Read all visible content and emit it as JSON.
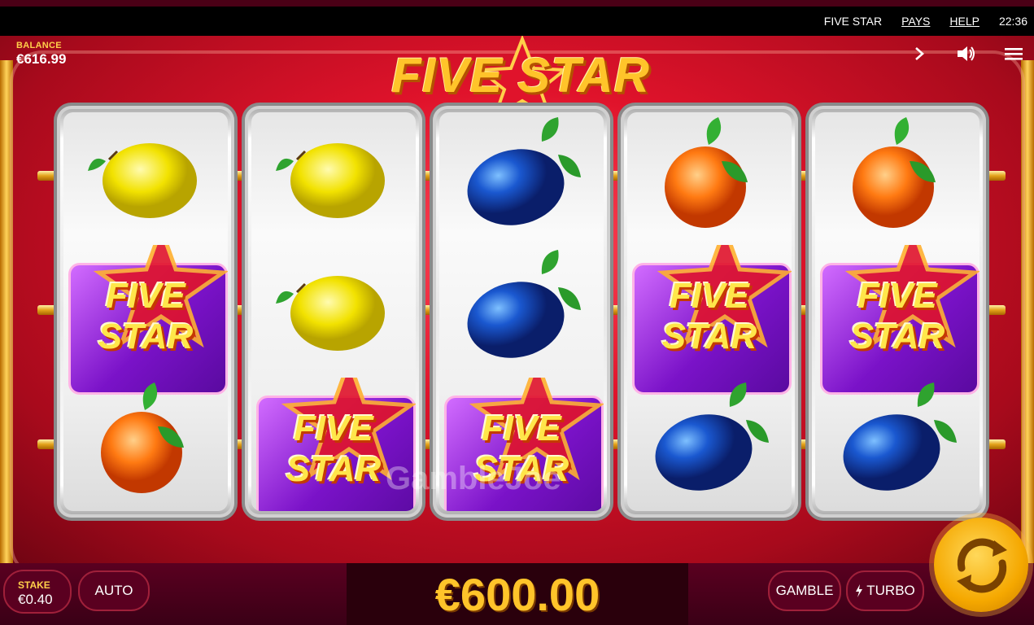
{
  "topbar": {
    "game_name": "FIVE STAR",
    "pays": "PAYS",
    "help": "HELP",
    "time": "22:36"
  },
  "balance": {
    "label": "BALANCE",
    "value": "€616.99"
  },
  "logo": {
    "text": "FIVE STAR"
  },
  "icons": {
    "next": "chevron-right-icon",
    "sound": "speaker-icon",
    "menu": "hamburger-menu-icon"
  },
  "reels": [
    [
      "lemon",
      "five-star",
      "orange"
    ],
    [
      "lemon",
      "lemon",
      "five-star"
    ],
    [
      "plum",
      "plum",
      "five-star"
    ],
    [
      "orange",
      "five-star",
      "plum"
    ],
    [
      "orange",
      "five-star",
      "plum"
    ]
  ],
  "symbol_text": {
    "five": "FIVE",
    "star": "STAR"
  },
  "watermark": "GambleJoe",
  "bottom": {
    "stake_label": "STAKE",
    "stake_value": "€0.40",
    "auto": "AUTO",
    "win": "€600.00",
    "gamble": "GAMBLE",
    "turbo": "TURBO"
  },
  "colors": {
    "accent_gold": "#ffc42a",
    "stage_red": "#e0132b",
    "bar_dark": "#3a0016"
  }
}
